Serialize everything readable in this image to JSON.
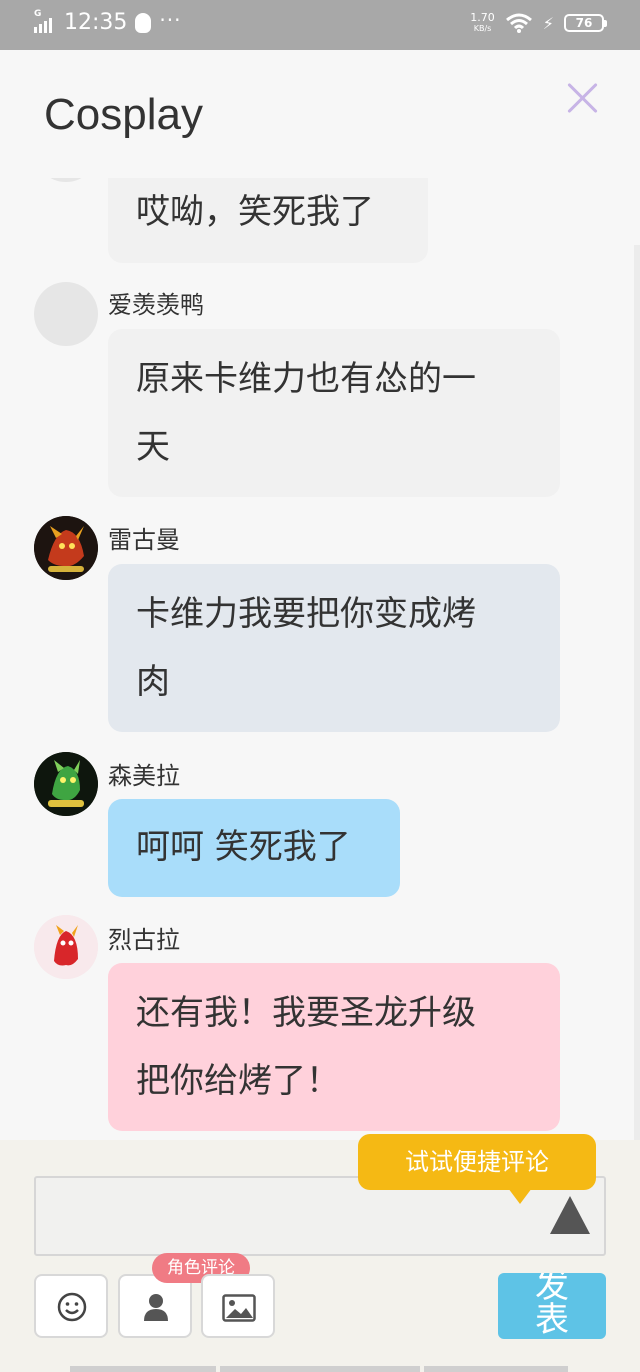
{
  "status_bar": {
    "network": "G",
    "time": "12:35",
    "more": "···",
    "speed_value": "1.70",
    "speed_unit": "KB/s",
    "battery": "76"
  },
  "header": {
    "title": "Cosplay"
  },
  "messages": [
    {
      "user": "",
      "text_lines": [
        "哎呦，笑死我了"
      ],
      "bubble_color": "#f1f1f1"
    },
    {
      "user": "爱羡羡鸭",
      "text_lines": [
        "原来卡维力也有怂的一",
        "天"
      ],
      "bubble_color": "#f1f1f1"
    },
    {
      "user": "雷古曼",
      "text_lines": [
        "卡维力我要把你变成烤",
        "肉"
      ],
      "bubble_color": "#e3e8ee"
    },
    {
      "user": "森美拉",
      "text_lines": [
        "呵呵 笑死我了"
      ],
      "bubble_color": "#a9ddfa"
    },
    {
      "user": "烈古拉",
      "text_lines": [
        "还有我！我要圣龙升级",
        "把你给烤了！"
      ],
      "bubble_color": "#ffd1db"
    }
  ],
  "composer": {
    "tooltip": "试试便捷评论",
    "role_comment_badge": "角色评论",
    "send_label": "发表"
  },
  "icons": [
    "emoji-icon",
    "person-icon",
    "image-icon",
    "close-icon",
    "up-arrow-icon"
  ]
}
